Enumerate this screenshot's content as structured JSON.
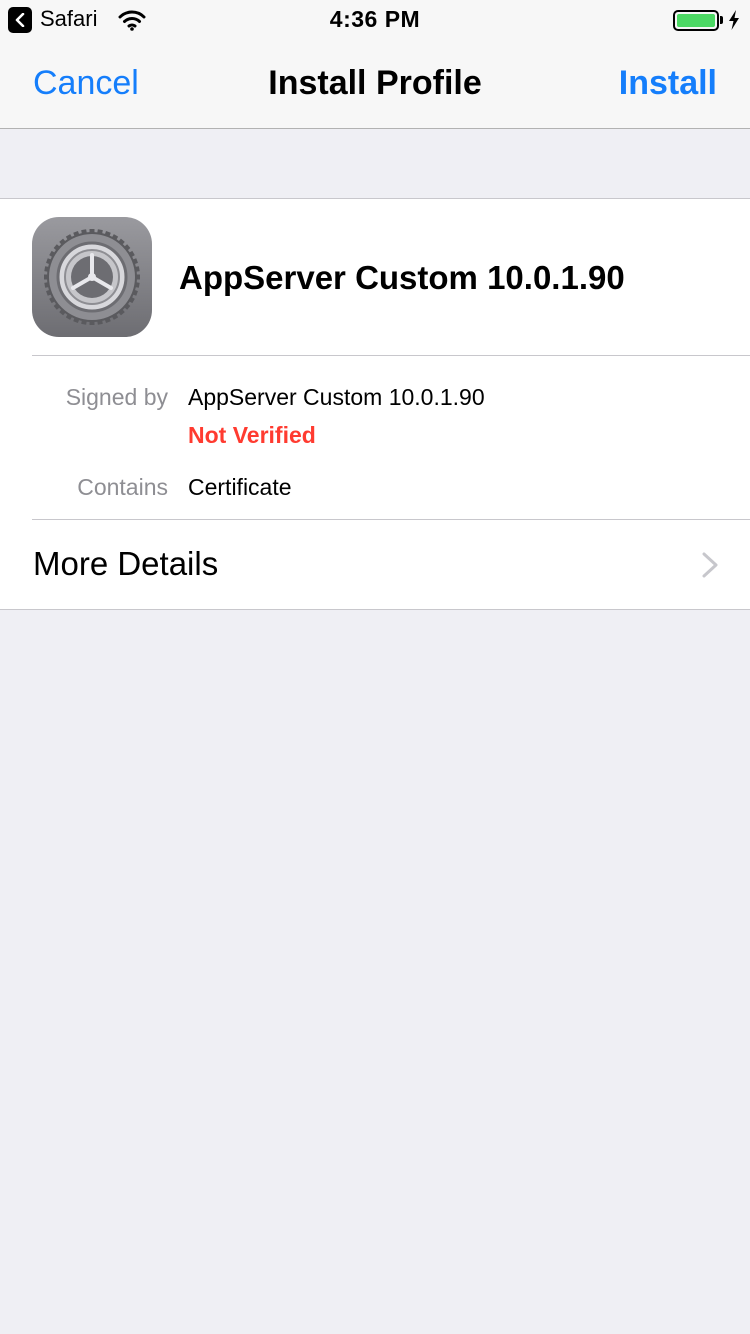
{
  "status_bar": {
    "back_app": "Safari",
    "time": "4:36 PM",
    "battery_level": 1.0,
    "charging": true,
    "icons": [
      "back-arrow-icon",
      "wifi-icon",
      "battery-icon",
      "charging-bolt-icon"
    ]
  },
  "nav": {
    "cancel_label": "Cancel",
    "title": "Install Profile",
    "install_label": "Install"
  },
  "profile": {
    "icon": "settings-gear-icon",
    "name": "AppServer Custom 10.0.1.90",
    "signed_by_label": "Signed by",
    "signed_by_value": "AppServer Custom 10.0.1.90",
    "verification_status": "Not Verified",
    "contains_label": "Contains",
    "contains_value": "Certificate",
    "more_details_label": "More Details"
  },
  "colors": {
    "accent": "#157efb",
    "warning": "#ff3b30",
    "battery": "#4cd964",
    "background": "#efeff4"
  }
}
